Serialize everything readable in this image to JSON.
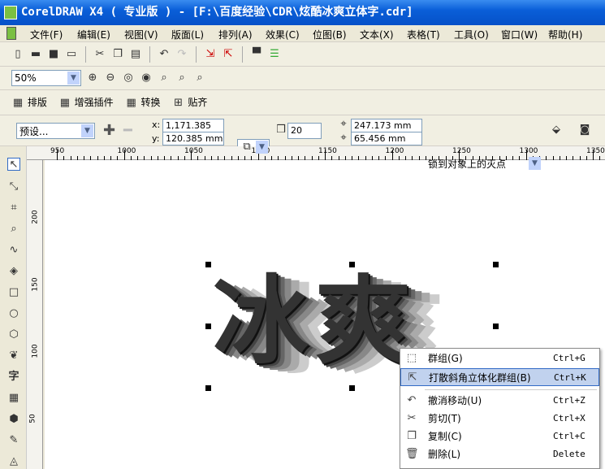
{
  "window": {
    "title": "CorelDRAW X4 ( 专业版 ) - [F:\\百度经验\\CDR\\炫酷冰爽立体字.cdr]"
  },
  "menubar": [
    "文件(F)",
    "编辑(E)",
    "视图(V)",
    "版面(L)",
    "排列(A)",
    "效果(C)",
    "位图(B)",
    "文本(X)",
    "表格(T)",
    "工具(O)",
    "窗口(W)",
    "帮助(H)"
  ],
  "zoom": {
    "value": "50%"
  },
  "plugins": [
    "排版",
    "增强插件",
    "转换",
    "贴齐"
  ],
  "property_bar": {
    "preset": "预设...",
    "x": "1,171.385 mm",
    "y": "120.385 mm",
    "x_label": "x:",
    "y_label": "y:",
    "depth": "20",
    "vp_x": "247.173 mm",
    "vp_y": "65.456 mm",
    "vanishing": "锁到对象上的灭点"
  },
  "ruler_h": [
    "950",
    "1000",
    "1050",
    "1100",
    "1150",
    "1200",
    "1250",
    "1300",
    "1350"
  ],
  "ruler_v": [
    "200",
    "150",
    "100",
    "50"
  ],
  "artwork_text": "冰爽",
  "context_menu": [
    {
      "label": "群组(G)",
      "shortcut": "Ctrl+G",
      "icon": "group-icon"
    },
    {
      "label": "打散斜角立体化群组(B)",
      "shortcut": "Ctrl+K",
      "icon": "break-apart-icon",
      "highlighted": true
    },
    {
      "label": "撤消移动(U)",
      "shortcut": "Ctrl+Z",
      "icon": "undo-icon"
    },
    {
      "label": "剪切(T)",
      "shortcut": "Ctrl+X",
      "icon": "scissors-icon"
    },
    {
      "label": "复制(C)",
      "shortcut": "Ctrl+C",
      "icon": "copy-icon"
    },
    {
      "label": "删除(L)",
      "shortcut": "Delete",
      "icon": "trash-icon"
    }
  ]
}
